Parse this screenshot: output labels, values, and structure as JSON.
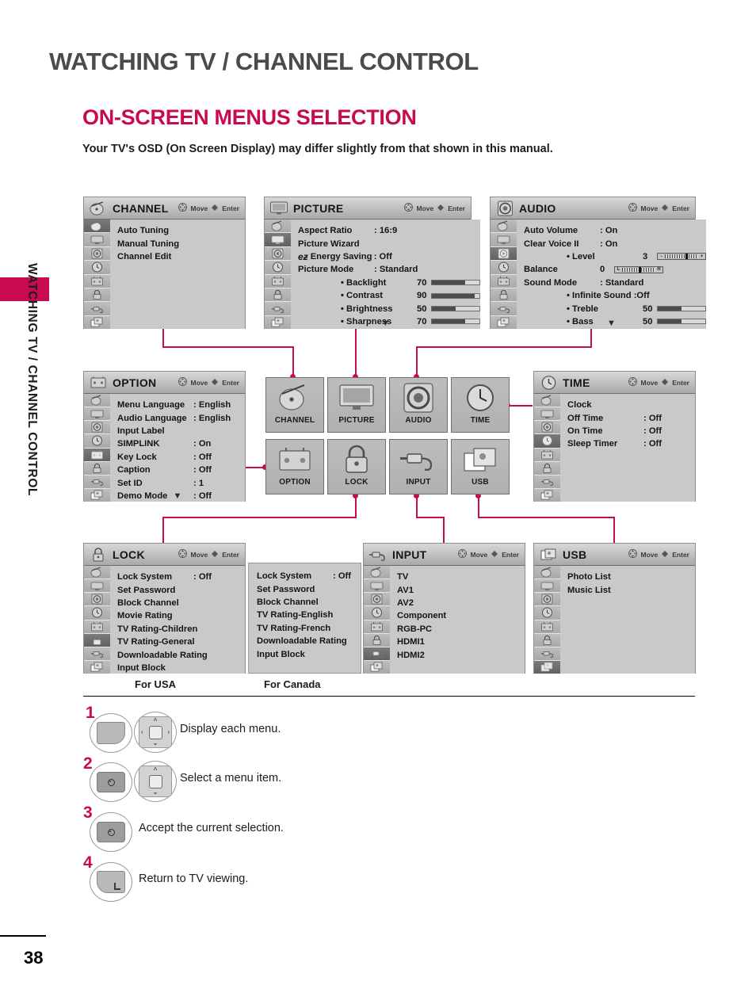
{
  "page": {
    "chapter_title": "WATCHING TV / CHANNEL CONTROL",
    "section_title": "ON-SCREEN MENUS SELECTION",
    "note": "Your TV's OSD (On Screen Display) may differ slightly from that shown in this manual.",
    "sidebar_text": "WATCHING TV / CHANNEL CONTROL",
    "page_number": "38",
    "accent_color": "#c80a50"
  },
  "hint": {
    "move": "Move",
    "enter": "Enter"
  },
  "menus": {
    "channel": {
      "title": "CHANNEL",
      "active_rail": 0,
      "rows": [
        {
          "label": "Auto Tuning",
          "value": ""
        },
        {
          "label": "Manual Tuning",
          "value": ""
        },
        {
          "label": "Channel Edit",
          "value": ""
        }
      ]
    },
    "picture": {
      "title": "PICTURE",
      "active_rail": 1,
      "rows": [
        {
          "label": "Aspect Ratio",
          "value": ": 16:9"
        },
        {
          "label": "Picture Wizard",
          "value": ""
        },
        {
          "label": "Energy Saving",
          "value": ": Off",
          "eco": true
        },
        {
          "label": "Picture Mode",
          "value": ": Standard"
        },
        {
          "label": "• Backlight",
          "value": "70",
          "bar": 70,
          "indent": true
        },
        {
          "label": "• Contrast",
          "value": "90",
          "bar": 90,
          "indent": true
        },
        {
          "label": "• Brightness",
          "value": "50",
          "bar": 50,
          "indent": true
        },
        {
          "label": "• Sharpness",
          "value": "70",
          "bar": 70,
          "indent": true
        }
      ],
      "more": "▼"
    },
    "audio": {
      "title": "AUDIO",
      "active_rail": 2,
      "rows": [
        {
          "label": "Auto Volume",
          "value": ": On"
        },
        {
          "label": "Clear Voice II",
          "value": ": On"
        },
        {
          "label": "• Level",
          "value": "3",
          "tick": {
            "left": "-",
            "right": "+",
            "pos": 62
          },
          "indent": true
        },
        {
          "label": "Balance",
          "value": "0",
          "tick": {
            "left": "L",
            "right": "R",
            "pos": 50
          }
        },
        {
          "label": "Sound Mode",
          "value": ": Standard"
        },
        {
          "label": "• Infinite Sound :Off",
          "value": "",
          "indent": true
        },
        {
          "label": "• Treble",
          "value": "50",
          "bar": 50,
          "indent": true
        },
        {
          "label": "• Bass",
          "value": "50",
          "bar": 50,
          "indent": true
        }
      ],
      "more": "▼"
    },
    "option": {
      "title": "OPTION",
      "active_rail": 4,
      "rows": [
        {
          "label": "Menu Language",
          "value": ": English"
        },
        {
          "label": "Audio Language",
          "value": ": English"
        },
        {
          "label": "Input Label",
          "value": ""
        },
        {
          "label": "SIMPLINK",
          "value": ": On"
        },
        {
          "label": "Key Lock",
          "value": ": Off"
        },
        {
          "label": "Caption",
          "value": ": Off"
        },
        {
          "label": "Set ID",
          "value": ": 1"
        },
        {
          "label": "Demo Mode",
          "value": ": Off"
        }
      ],
      "more": "▼"
    },
    "time": {
      "title": "TIME",
      "active_rail": 3,
      "rows": [
        {
          "label": "Clock",
          "value": ""
        },
        {
          "label": "Off Time",
          "value": ": Off"
        },
        {
          "label": "On Time",
          "value": ": Off"
        },
        {
          "label": "Sleep Timer",
          "value": ": Off"
        }
      ]
    },
    "lock": {
      "title": "LOCK",
      "active_rail": 5,
      "rows": [
        {
          "label": "Lock System",
          "value": ": Off"
        },
        {
          "label": "Set Password",
          "value": ""
        },
        {
          "label": "Block Channel",
          "value": ""
        },
        {
          "label": "Movie Rating",
          "value": ""
        },
        {
          "label": "TV Rating-Children",
          "value": ""
        },
        {
          "label": "TV Rating-General",
          "value": ""
        },
        {
          "label": "Downloadable Rating",
          "value": ""
        },
        {
          "label": "Input Block",
          "value": ""
        }
      ]
    },
    "lock_canada": {
      "rows": [
        {
          "label": "Lock System",
          "value": ": Off"
        },
        {
          "label": "Set Password",
          "value": ""
        },
        {
          "label": "Block Channel",
          "value": ""
        },
        {
          "label": "TV Rating-English",
          "value": ""
        },
        {
          "label": "TV Rating-French",
          "value": ""
        },
        {
          "label": "Downloadable Rating",
          "value": ""
        },
        {
          "label": "Input Block",
          "value": ""
        }
      ]
    },
    "input": {
      "title": "INPUT",
      "active_rail": 6,
      "rows": [
        {
          "label": "TV",
          "value": ""
        },
        {
          "label": "AV1",
          "value": ""
        },
        {
          "label": "AV2",
          "value": ""
        },
        {
          "label": "Component",
          "value": ""
        },
        {
          "label": "RGB-PC",
          "value": ""
        },
        {
          "label": "HDMI1",
          "value": ""
        },
        {
          "label": "HDMI2",
          "value": ""
        }
      ]
    },
    "usb": {
      "title": "USB",
      "active_rail": 7,
      "rows": [
        {
          "label": "Photo List",
          "value": ""
        },
        {
          "label": "Music List",
          "value": ""
        }
      ]
    }
  },
  "region_labels": {
    "usa": "For USA",
    "canada": "For Canada"
  },
  "tiles": [
    {
      "label": "CHANNEL",
      "icon": "satellite-dish-icon"
    },
    {
      "label": "PICTURE",
      "icon": "tv-monitor-icon"
    },
    {
      "label": "AUDIO",
      "icon": "speaker-icon"
    },
    {
      "label": "TIME",
      "icon": "clock-icon"
    },
    {
      "label": "OPTION",
      "icon": "option-icon"
    },
    {
      "label": "LOCK",
      "icon": "padlock-icon"
    },
    {
      "label": "INPUT",
      "icon": "input-plug-icon"
    },
    {
      "label": "USB",
      "icon": "usb-media-icon"
    }
  ],
  "steps": [
    {
      "num": "1",
      "text": "Display each menu."
    },
    {
      "num": "2",
      "text": "Select a menu item."
    },
    {
      "num": "3",
      "text": "Accept the current selection."
    },
    {
      "num": "4",
      "text": "Return to TV viewing."
    }
  ]
}
